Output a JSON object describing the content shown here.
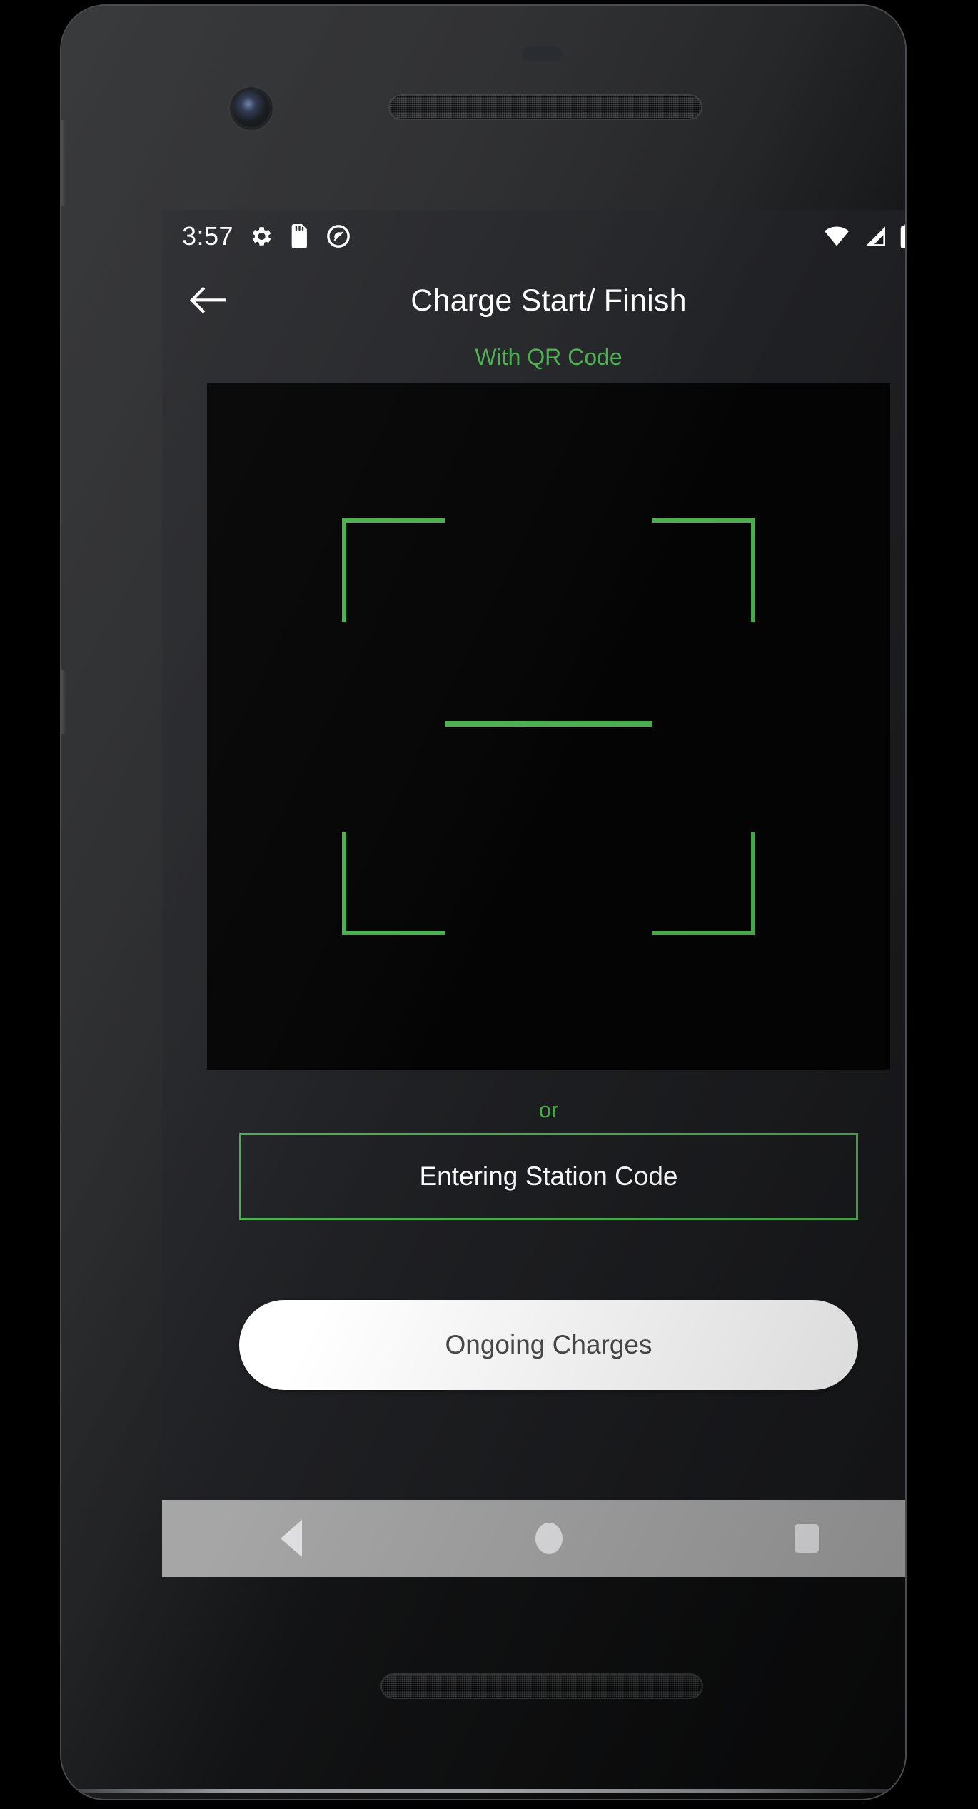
{
  "device": {
    "label": "android-phone",
    "front_camera_icon": "camera-icon",
    "earpiece_icon": "speaker-grille-icon",
    "bottom_speaker_icon": "speaker-grille-icon"
  },
  "status_bar": {
    "time": "3:57",
    "left_icons": [
      "gear-icon",
      "sd-card-icon",
      "do-not-disturb-icon"
    ],
    "right_icons": [
      "wifi-icon",
      "cellular-signal-icon",
      "battery-icon"
    ]
  },
  "app_bar": {
    "back_icon": "back-arrow-icon",
    "title": "Charge Start/ Finish"
  },
  "content": {
    "subtitle": "With QR Code",
    "scanner": {
      "name": "qr-scanner-viewfinder",
      "corner_color": "#4CAF50",
      "scan_line_color": "#4CAF50",
      "preview_background": "#040404"
    },
    "or_label": "or",
    "station_code_button": "Entering Station Code",
    "ongoing_charges_button": "Ongoing Charges"
  },
  "nav_bar": {
    "back": "nav-back-icon",
    "home": "nav-home-icon",
    "recents": "nav-recents-icon",
    "background": "#a6a6a6"
  },
  "theme": {
    "accent_green": "#4CAF50",
    "screen_background": "#202124",
    "text_primary": "#ffffff",
    "pill_text": "#4a4a4a"
  }
}
